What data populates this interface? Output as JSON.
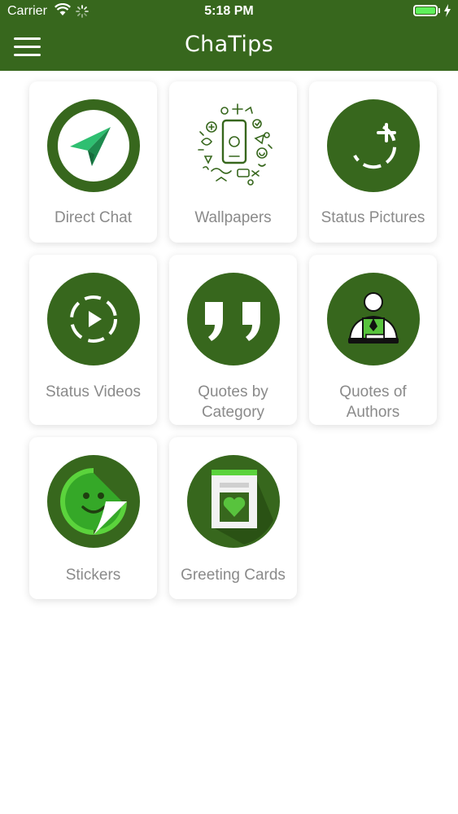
{
  "status_bar": {
    "carrier": "Carrier",
    "time": "5:18 PM"
  },
  "header": {
    "title": "ChaTips"
  },
  "colors": {
    "brand_green": "#37671d",
    "label_gray": "#8a8a8a",
    "accent_green": "#3cc341"
  },
  "tiles": [
    {
      "label": "Direct Chat",
      "icon": "paper-plane-icon"
    },
    {
      "label": "Wallpapers",
      "icon": "wallpaper-doodle-icon"
    },
    {
      "label": "Status Pictures",
      "icon": "status-add-icon"
    },
    {
      "label": "Status Videos",
      "icon": "status-play-icon"
    },
    {
      "label_lines": [
        "Quotes by",
        "Category"
      ],
      "icon": "quote-marks-icon"
    },
    {
      "label_lines": [
        "Quotes of",
        "Authors"
      ],
      "icon": "author-icon"
    },
    {
      "label": "Stickers",
      "icon": "sticker-smiley-icon"
    },
    {
      "label": "Greeting Cards",
      "icon": "greeting-card-icon"
    }
  ]
}
